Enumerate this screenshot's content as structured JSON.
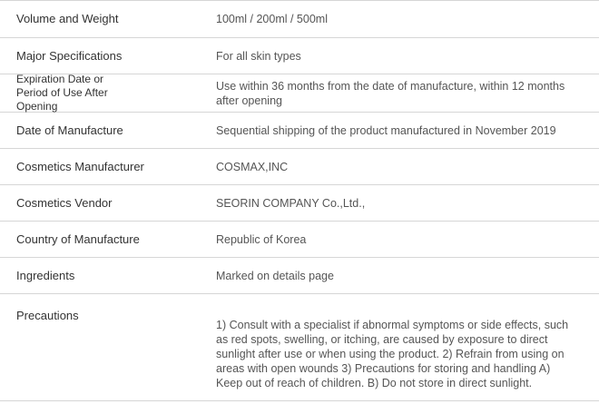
{
  "rows": [
    {
      "label": "Volume and Weight",
      "value": "100ml / 200ml / 500ml"
    },
    {
      "label": "Major Specifications",
      "value": "For all skin types"
    },
    {
      "label": "Expiration Date or Period of Use After Opening",
      "value": "Use within 36 months from the date of manufacture, within 12 months after opening"
    },
    {
      "label": "Date of Manufacture",
      "value": "Sequential shipping of the product manufactured in November 2019"
    },
    {
      "label": "Cosmetics Manufacturer",
      "value": "COSMAX,INC"
    },
    {
      "label": "Cosmetics Vendor",
      "value": "SEORIN COMPANY Co.,Ltd.,"
    },
    {
      "label": "Country of Manufacture",
      "value": "Republic of Korea"
    },
    {
      "label": "Ingredients",
      "value": "Marked on details page"
    },
    {
      "label": "Precautions",
      "value": "1) Consult with a specialist if abnormal symptoms or side effects, such as red spots, swelling, or itching, are caused by exposure to direct sunlight after use or when using the product. 2) Refrain from using on areas with open wounds 3) Precautions for storing and handling A) Keep out of reach of children. B) Do not store in direct sunlight."
    }
  ]
}
